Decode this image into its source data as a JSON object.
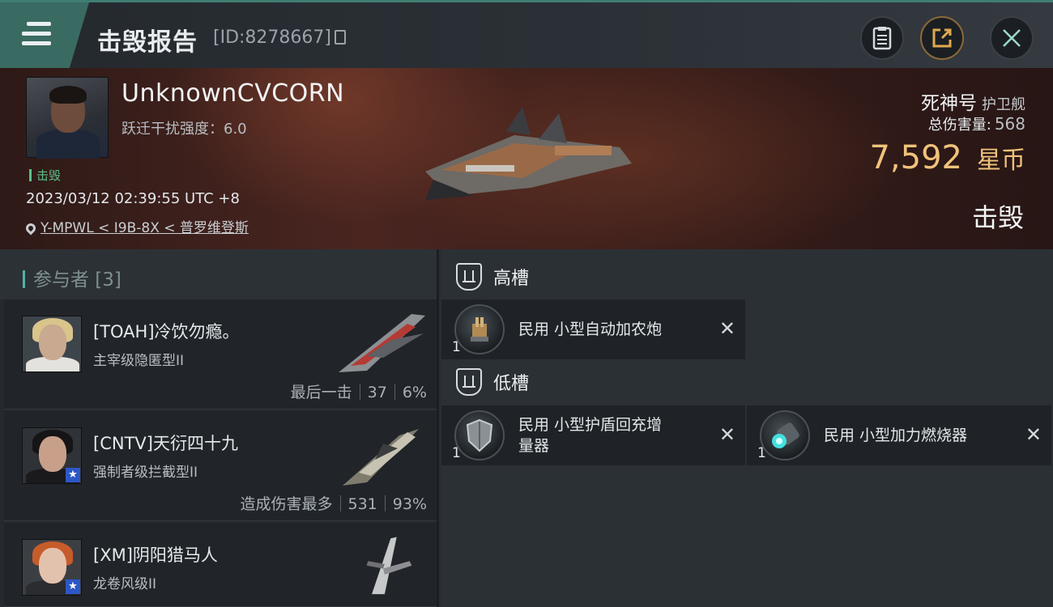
{
  "header": {
    "title": "击毁报告",
    "kill_id": "[ID:8278667]",
    "buttons": [
      "clipboard-icon",
      "share-icon",
      "close-icon"
    ],
    "accent_color": "#3a6b62"
  },
  "victim": {
    "pilot_name": "UnknownCVCORN",
    "warp_strength": "跃迁干扰强度：6.0",
    "tag": "击毁",
    "datetime": "2023/03/12 02:39:55 UTC +8",
    "location": "Y-MPWL < I9B-8X < 普罗维登斯",
    "ship_name": "死神号",
    "ship_class": "护卫舰",
    "total_damage_label": "总伤害量:",
    "total_damage": "568",
    "isk_value": "7,592",
    "isk_unit": "星币",
    "status": "击毁"
  },
  "participants": {
    "header": "参与者 [3]",
    "items": [
      {
        "name": "[TOAH]冷饮勿瘾。",
        "ship": "主宰级隐匿型II",
        "stat_label": "最后一击",
        "damage": "37",
        "percent": "6%"
      },
      {
        "name": "[CNTV]天衍四十九",
        "ship": "强制者级拦截型II",
        "stat_label": "造成伤害最多",
        "damage": "531",
        "percent": "93%"
      },
      {
        "name": "[XM]阴阳猎马人",
        "ship": "龙卷风级II"
      }
    ]
  },
  "fitting": {
    "high_slots": {
      "label": "高槽",
      "modules": [
        {
          "name": "民用 小型自动加农炮",
          "qty": "1",
          "icon": "autocannon-icon"
        }
      ]
    },
    "low_slots": {
      "label": "低槽",
      "modules": [
        {
          "name_line1": "民用 小型护盾回充增",
          "name_line2": "量器",
          "qty": "1",
          "icon": "shield-recharger-icon"
        },
        {
          "name": "民用 小型加力燃烧器",
          "qty": "1",
          "icon": "afterburner-icon"
        }
      ]
    }
  }
}
